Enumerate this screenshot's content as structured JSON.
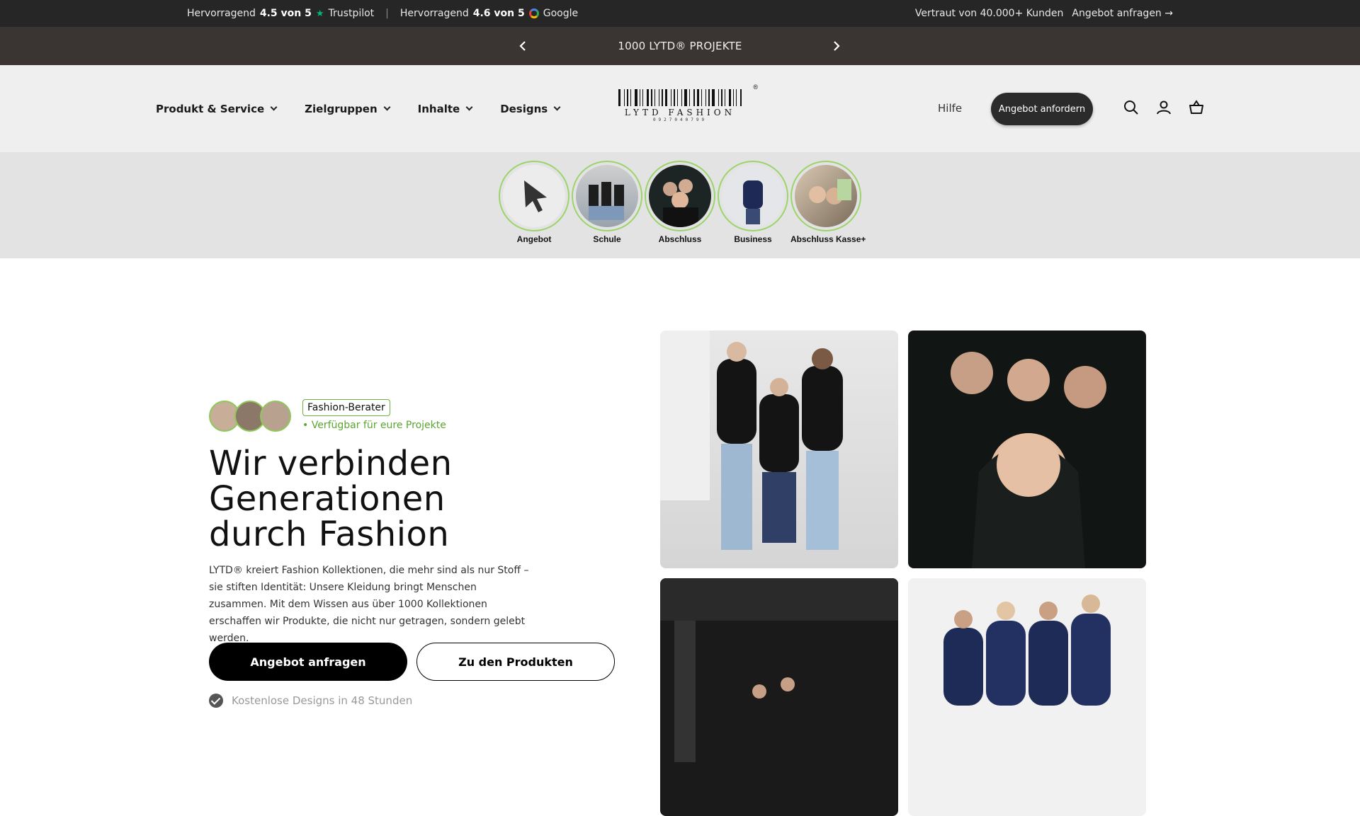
{
  "topbar": {
    "rating1_prefix": "Hervorragend",
    "rating1_score": "4.5 von 5",
    "rating1_source": "Trustpilot",
    "rating2_prefix": "Hervorragend",
    "rating2_score": "4.6 von 5",
    "rating2_source": "Google",
    "trust_text": "Vertraut von 40.000+ Kunden",
    "cta_link": "Angebot anfragen →"
  },
  "announcement": {
    "text": "1000 LYTD® PROJEKTE",
    "prev_icon": "chevron-left-icon",
    "next_icon": "chevron-right-icon"
  },
  "header": {
    "nav": [
      {
        "label": "Produkt & Service"
      },
      {
        "label": "Zielgruppen"
      },
      {
        "label": "Inhalte"
      },
      {
        "label": "Designs"
      }
    ],
    "logo_brand": "LYTD FASHION",
    "logo_digits": "0927040799",
    "logo_reg": "®",
    "help_label": "Hilfe",
    "cta_label": "Angebot anfordern",
    "icons": [
      "search-icon",
      "account-icon",
      "cart-icon"
    ]
  },
  "stories": [
    {
      "label": "Angebot"
    },
    {
      "label": "Schule"
    },
    {
      "label": "Abschluss"
    },
    {
      "label": "Business"
    },
    {
      "label": "Abschluss Kasse+"
    }
  ],
  "hero": {
    "badge": "Fashion-Berater",
    "availability": "• Verfügbar für eure Projekte",
    "headline_line1": "Wir verbinden",
    "headline_line2": "Generationen",
    "headline_line3": "durch Fashion",
    "lead": "LYTD® kreiert Fashion Kollektionen, die mehr sind als nur Stoff – sie stiften Identität: Unsere Kleidung bringt Menschen zusammen. Mit dem Wissen aus über 1000 Kollektionen erschaffen wir Produkte, die nicht nur getragen, sondern gelebt werden.",
    "primary_button": "Angebot anfragen",
    "secondary_button": "Zu den Produkten",
    "feature": "Kostenlose Designs in 48 Stunden"
  },
  "colors": {
    "accent_green": "#8dc859",
    "dark": "#262626",
    "announce_bg": "#3a3433"
  }
}
